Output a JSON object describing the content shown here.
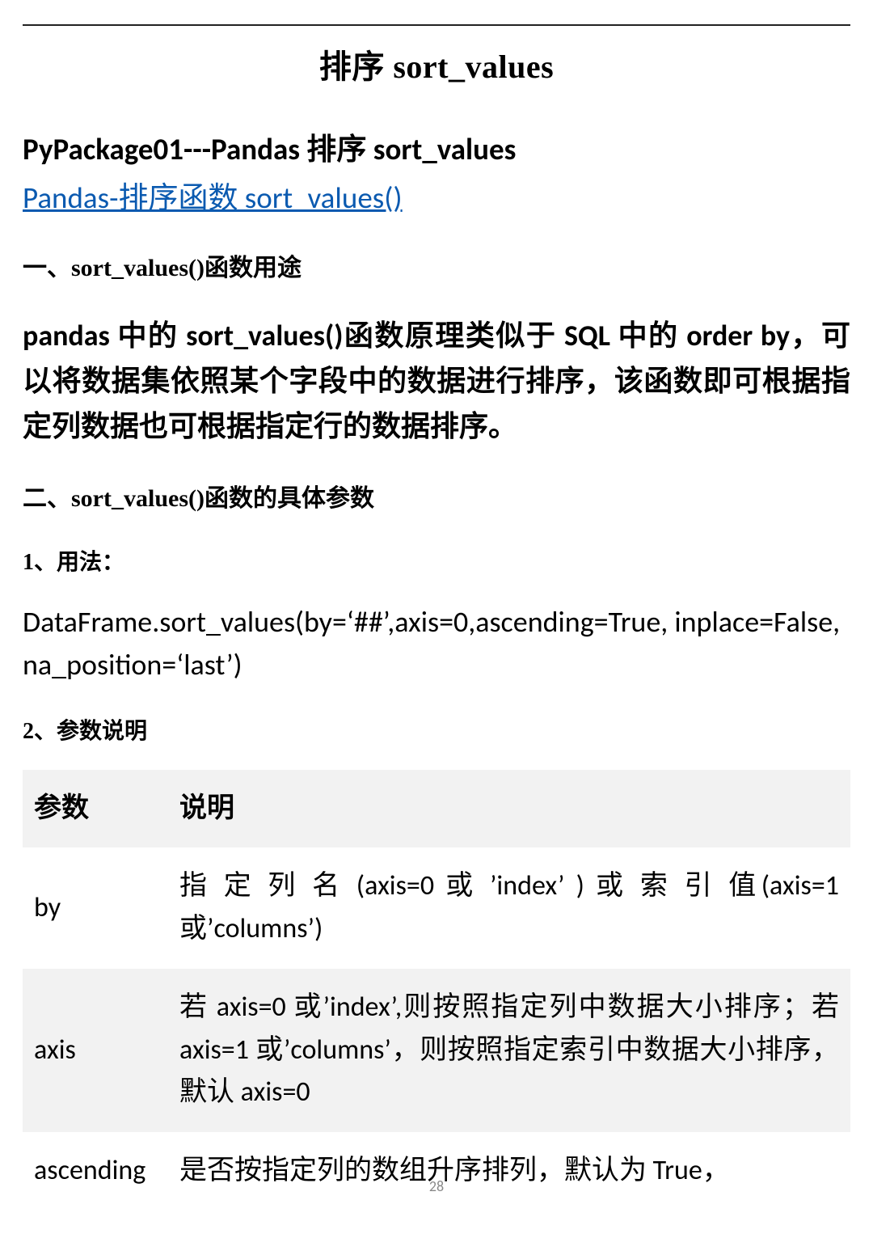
{
  "title": "排序 sort_values",
  "heading1": "PyPackage01---Pandas 排序 sort_values",
  "link_text": "Pandas-排序函数 sort_values()",
  "section1_head": "一、sort_values()函数用途",
  "section1_body": "pandas 中的 sort_values()函数原理类似于 SQL 中的 order by，可以将数据集依照某个字段中的数据进行排序，该函数即可根据指定列数据也可根据指定行的数据排序。",
  "section2_head": "二、sort_values()函数的具体参数",
  "sub1_head": "1、用法：",
  "usage_code": "DataFrame.sort_values(by=‘##’,axis=0,ascending=True, inplace=False, na_position=‘last’)",
  "sub2_head": "2、参数说明",
  "table": {
    "header": {
      "c0": "参数",
      "c1": "说明"
    },
    "rows": [
      {
        "param": "by",
        "desc": "指 定 列 名 (axis=0  或 ’index’ ) 或 索 引 值(axis=1 或’columns’)"
      },
      {
        "param": "axis",
        "desc": "若 axis=0 或’index’,则按照指定列中数据大小排序；若 axis=1 或’columns’，则按照指定索引中数据大小排序，默认 axis=0"
      },
      {
        "param": "ascending",
        "desc": "是否按指定列的数组升序排列，默认为 True，"
      }
    ]
  },
  "page_number": "28"
}
